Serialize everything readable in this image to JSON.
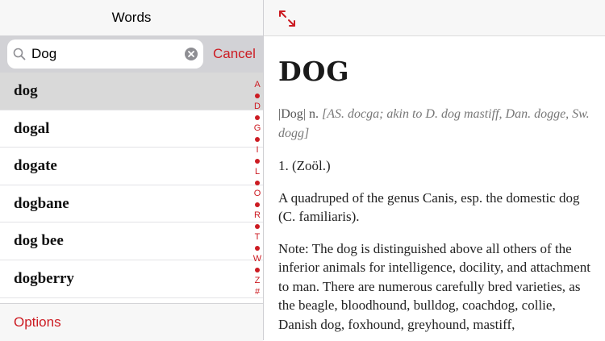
{
  "sidebar": {
    "title": "Words",
    "search": {
      "value": "Dog",
      "cancel_label": "Cancel"
    },
    "words": [
      "dog",
      "dogal",
      "dogate",
      "dogbane",
      "dog bee",
      "dogberry"
    ],
    "selected_word": "dog",
    "index": [
      "A",
      "•",
      "D",
      "•",
      "G",
      "•",
      "I",
      "•",
      "L",
      "•",
      "O",
      "•",
      "R",
      "•",
      "T",
      "•",
      "W",
      "•",
      "Z",
      "#"
    ],
    "options_label": "Options"
  },
  "detail": {
    "headword": "DOG",
    "pronunciation": "|Dog| n.",
    "etymology": "[AS. docga; akin to D. dog mastiff, Dan. dogge, Sw. dogg]",
    "sense_number": "1. (Zoöl.)",
    "definition": "A quadruped of the genus Canis, esp. the domestic dog (C. familiaris).",
    "note": "Note: The dog is distinguished above all others of the inferior animals for intelligence, docility, and attachment to man. There are numerous carefully bred varieties, as the beagle, bloodhound, bulldog, coachdog, collie, Danish dog, foxhound, greyhound, mastiff,"
  },
  "colors": {
    "accent": "#cc1b22",
    "selected_row": "#d9d9d9",
    "search_bar": "#d2d2d6"
  }
}
